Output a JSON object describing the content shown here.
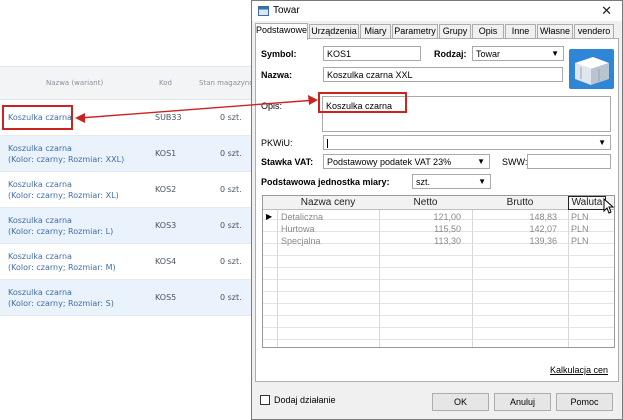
{
  "web_table": {
    "columns": [
      "Nazwa (wariant)",
      "Kod",
      "Stan magazynow"
    ],
    "rows": [
      {
        "name1": "Koszulka czarna",
        "name2": "",
        "kod": "SUB33",
        "stan": "0 szt."
      },
      {
        "name1": "Koszulka czarna",
        "name2": "(Kolor: czarny; Rozmiar: XXL)",
        "kod": "KOS1",
        "stan": "0 szt."
      },
      {
        "name1": "Koszulka czarna",
        "name2": "(Kolor: czarny; Rozmiar: XL)",
        "kod": "KOS2",
        "stan": "0 szt."
      },
      {
        "name1": "Koszulka czarna",
        "name2": "(Kolor: czarny; Rozmiar: L)",
        "kod": "KOS3",
        "stan": "0 szt."
      },
      {
        "name1": "Koszulka czarna",
        "name2": "(Kolor: czarny; Rozmiar: M)",
        "kod": "KOS4",
        "stan": "0 szt."
      },
      {
        "name1": "Koszulka czarna",
        "name2": "(Kolor: czarny; Rozmiar: S)",
        "kod": "KOS5",
        "stan": "0 szt."
      }
    ]
  },
  "dialog": {
    "title": "Towar",
    "close_glyph": "✕",
    "tabs": [
      "Podstawowe",
      "Urządzenia",
      "Miary",
      "Parametry",
      "Grupy",
      "Opis",
      "Inne",
      "Własne",
      "vendero"
    ],
    "symbol": {
      "label": "Symbol:",
      "value": "KOS1"
    },
    "rodzaj": {
      "label": "Rodzaj:",
      "value": "Towar"
    },
    "nazwa": {
      "label": "Nazwa:",
      "value": "Koszulka czarna XXL"
    },
    "opis": {
      "label": "Opis:",
      "value": "Koszulka czarna"
    },
    "pkwiu": {
      "label": "PKWiU:",
      "value": ""
    },
    "vat": {
      "label": "Stawka VAT:",
      "value": "Podstawowy podatek VAT 23%"
    },
    "sww": {
      "label": "SWW:",
      "value": ""
    },
    "jednostka": {
      "label": "Podstawowa jednostka miary:",
      "value": "szt."
    },
    "price_grid": {
      "headers": [
        "Nazwa ceny",
        "Netto",
        "Brutto",
        "Waluta"
      ],
      "rows": [
        {
          "name": "Detaliczna",
          "netto": "121,00",
          "brutto": "148,83",
          "waluta": "PLN"
        },
        {
          "name": "Hurtowa",
          "netto": "115,50",
          "brutto": "142,07",
          "waluta": "PLN"
        },
        {
          "name": "Specjalna",
          "netto": "113,30",
          "brutto": "139,36",
          "waluta": "PLN"
        }
      ]
    },
    "kalkulacja_link": "Kalkulacja cen",
    "dodaj_dzialanie": "Dodaj działanie",
    "buttons": {
      "ok": "OK",
      "cancel": "Anuluj",
      "help": "Pomoc"
    }
  },
  "colors": {
    "annotation_red": "#cc2222",
    "link_blue": "#3f6ea8",
    "highlight_row": "#eaf2fb"
  },
  "icons": {
    "title": "app-window-icon",
    "product": "box-package-icon",
    "cursor": "mouse-cursor-icon",
    "row_pointer": "triangle-right-icon"
  }
}
